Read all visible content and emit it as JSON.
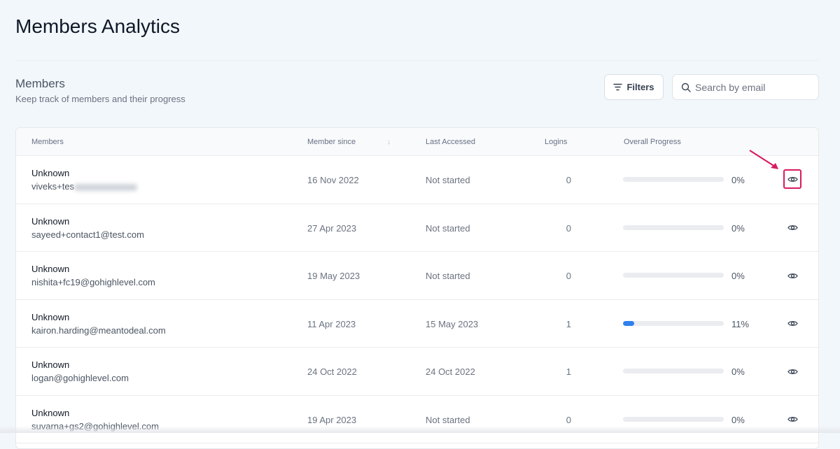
{
  "page": {
    "title": "Members Analytics"
  },
  "section": {
    "title": "Members",
    "subtitle": "Keep track of members and their progress"
  },
  "toolbar": {
    "filters_label": "Filters",
    "search_placeholder": "Search by email"
  },
  "table": {
    "headers": {
      "members": "Members",
      "member_since": "Member since",
      "last_accessed": "Last Accessed",
      "logins": "Logins",
      "progress": "Overall Progress"
    },
    "rows": [
      {
        "name": "Unknown",
        "email": "viveks+tes",
        "since": "16 Nov 2022",
        "accessed": "Not started",
        "logins": "0",
        "progress": 0,
        "pct": "0%"
      },
      {
        "name": "Unknown",
        "email": "sayeed+contact1@test.com",
        "since": "27 Apr 2023",
        "accessed": "Not started",
        "logins": "0",
        "progress": 0,
        "pct": "0%"
      },
      {
        "name": "Unknown",
        "email": "nishita+fc19@gohighlevel.com",
        "since": "19 May 2023",
        "accessed": "Not started",
        "logins": "0",
        "progress": 0,
        "pct": "0%"
      },
      {
        "name": "Unknown",
        "email": "kairon.harding@meantodeal.com",
        "since": "11 Apr 2023",
        "accessed": "15 May 2023",
        "logins": "1",
        "progress": 11,
        "pct": "11%"
      },
      {
        "name": "Unknown",
        "email": "logan@gohighlevel.com",
        "since": "24 Oct 2022",
        "accessed": "24 Oct 2022",
        "logins": "1",
        "progress": 0,
        "pct": "0%"
      },
      {
        "name": "Unknown",
        "email": "suvarna+gs2@gohighlevel.com",
        "since": "19 Apr 2023",
        "accessed": "Not started",
        "logins": "0",
        "progress": 0,
        "pct": "0%"
      }
    ]
  },
  "colors": {
    "accent": "#2f80ed",
    "highlight": "#d81b60"
  }
}
